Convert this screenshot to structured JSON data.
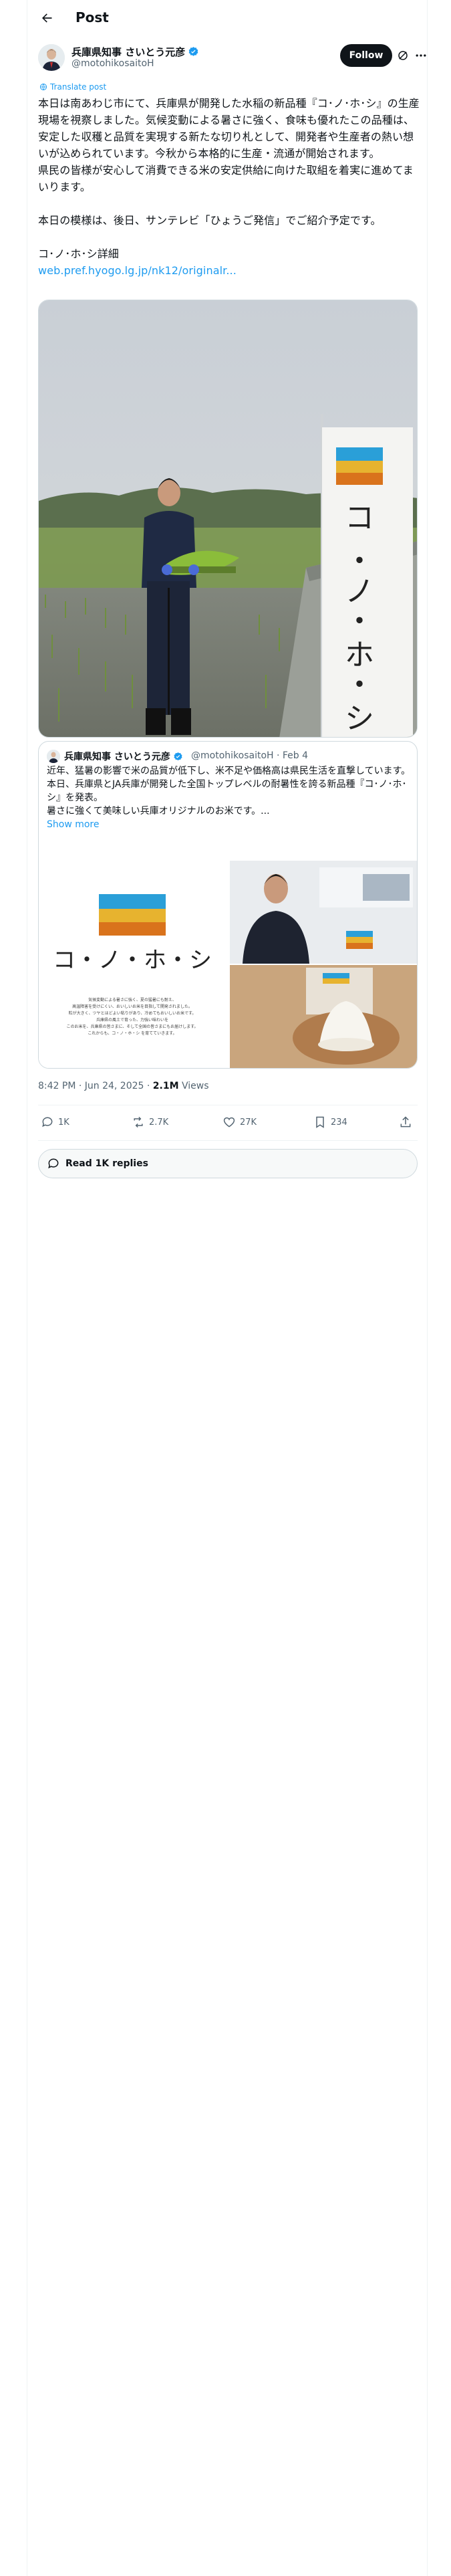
{
  "header": {
    "title": "Post"
  },
  "author": {
    "name": "兵庫県知事 さいとう元彦",
    "handle": "@motohikosaitoH",
    "follow_label": "Follow"
  },
  "translate_label": "Translate post",
  "tweet": {
    "paragraph1": "本日は南あわじ市にて、兵庫県が開発した水稲の新品種『コ･ノ･ホ･シ』の生産現場を視察しました。気候変動による暑さに強く、食味も優れたこの品種は、安定した収穫と品質を実現する新たな切り札として、開発者や生産者の熱い想いが込められています。今秋から本格的に生産・流通が開始されます。",
    "paragraph2": "県民の皆様が安心して消費できる米の安定供給に向けた取組を着実に進めてまいります。",
    "paragraph3": "本日の模様は、後日、サンテレビ「ひょうご発信」でご紹介予定です。",
    "link_title": "コ･ノ･ホ･シ詳細",
    "link_url": "web.pref.hyogo.lg.jp/nk12/originalr..."
  },
  "main_image": {
    "banner_text": "コ・ノ・ホ・シ"
  },
  "quote": {
    "name": "兵庫県知事 さいとう元彦",
    "handle_date": "@motohikosaitoH · Feb 4",
    "line1": "近年、猛暑の影響で米の品質が低下し、米不足や価格高は県民生活を直撃しています。",
    "line2": "本日、兵庫県とJA兵庫が開発した全国トップレベルの耐暑性を誇る新品種『コ･ノ･ホ･シ』を発表。",
    "line3": "暑さに強くて美味しい兵庫オリジナルのお米です。...",
    "show_more": "Show more",
    "logo_text": "コ・ノ・ホ・シ",
    "caption_lines": [
      "気候変動による暑さに強く、夏の猛暑にも耐え、",
      "高温障害を受けにくい、おいしいお米を目指して開発されました。",
      "粒が大きく、ツヤとほどよい粘りがあり、冷めてもおいしいお米です。",
      "兵庫県の風土で育った、力強い味わいを",
      "このお米を、兵庫県の皆さまに、そして全国の皆さまにもお届けします。",
      "これからも、コ・ノ・ホ・シ を育てていきます。"
    ]
  },
  "meta": {
    "time": "8:42 PM · Jun 24, 2025 · ",
    "views_count": "2.1M",
    "views_label": " Views"
  },
  "actions": {
    "replies": "1K",
    "reposts": "2.7K",
    "likes": "27K",
    "bookmarks": "234"
  },
  "read_replies_label": "Read 1K replies",
  "colors": {
    "accent": "#1d9bf0",
    "text": "#0f1419",
    "secondary": "#536471",
    "border": "#cfd9de",
    "logo_blue": "#2a9fd8",
    "logo_gold": "#e7b32f",
    "logo_orange": "#d9731c"
  }
}
